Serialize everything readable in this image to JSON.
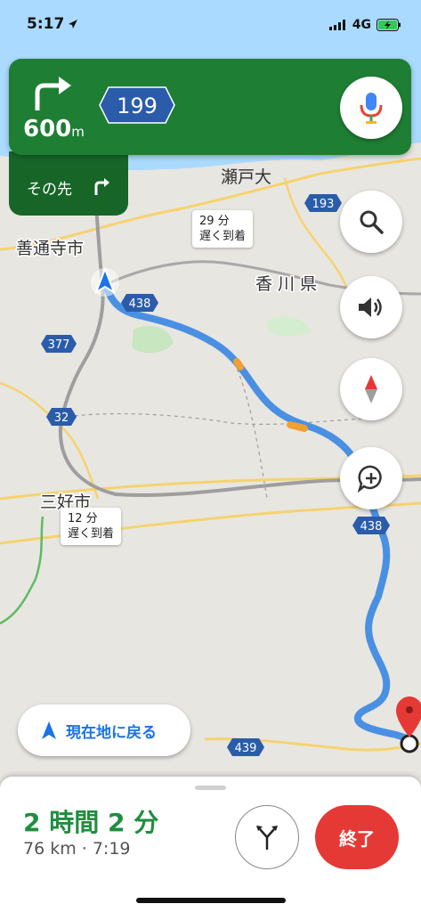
{
  "status_bar": {
    "time": "5:17",
    "network": "4G"
  },
  "navigation": {
    "distance": "600",
    "distance_unit": "m",
    "route_shield": "199",
    "then_label": "その先",
    "primary_turn": "turn-right-icon",
    "then_turn": "turn-right-icon"
  },
  "map": {
    "place_labels": [
      "瀬戸大",
      "善通寺市",
      "香川県",
      "三好市"
    ],
    "road_shields": [
      "193",
      "438",
      "377",
      "32",
      "438",
      "439"
    ],
    "callouts": [
      {
        "time": "29 分",
        "note": "遅く到着"
      },
      {
        "time": "12 分",
        "note": "遅く到着"
      }
    ]
  },
  "recenter_label": "現在地に戻る",
  "trip": {
    "duration": "2 時間 2 分",
    "summary": "76 km · 7:19",
    "end_label": "終了"
  },
  "colors": {
    "nav_green": "#1e7e34",
    "nav_green_dark": "#176628",
    "route_blue": "#4a90e2",
    "end_red": "#e53935",
    "eta_green": "#1e8e3e"
  }
}
